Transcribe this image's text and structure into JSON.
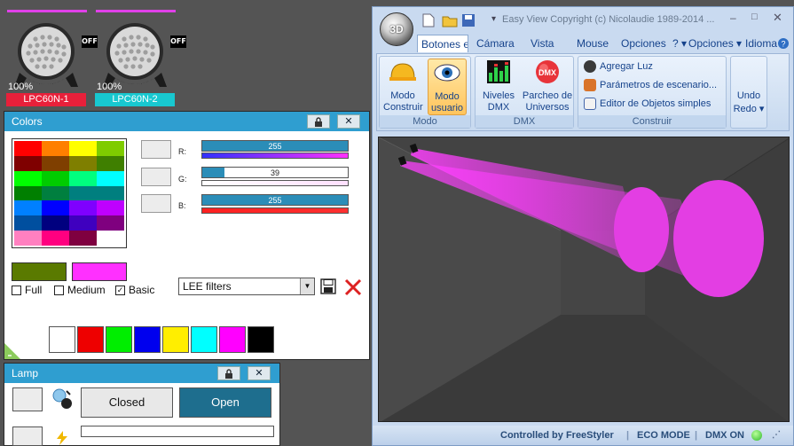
{
  "fixtures": [
    {
      "percent": "100%",
      "name": "LPC60N-1",
      "name_bg": "#e8203a",
      "status": "OFF"
    },
    {
      "percent": "100%",
      "name": "LPC60N-2",
      "name_bg": "#18c8d0",
      "status": "OFF"
    }
  ],
  "colors_panel": {
    "title": "Colors",
    "lock_icon": "lock-icon",
    "close_label": "✕",
    "palette": [
      "#ff0000",
      "#ff7f00",
      "#ffff00",
      "#7fcc00",
      "#7f0000",
      "#7f3f00",
      "#7f7f00",
      "#3f7f00",
      "#00ff00",
      "#00cc00",
      "#00ff7f",
      "#00ffff",
      "#007f00",
      "#007f3f",
      "#007f7f",
      "#007f7f",
      "#0080ff",
      "#0000ff",
      "#7f00ff",
      "#bf00ff",
      "#004f9f",
      "#00007f",
      "#3f00bf",
      "#7f007f",
      "#ff80c0",
      "#ff0080",
      "#7f0040",
      "#ffffff"
    ],
    "r_label": "R:",
    "g_label": "G:",
    "b_label": "B:",
    "r_value": "255",
    "g_value": "39",
    "b_value": "255",
    "r_fraction": 1.0,
    "g_fraction": 0.153,
    "b_fraction": 1.0,
    "current_color": "#ff30ff",
    "previous_color": "#5a7a00",
    "option_full": "Full",
    "option_medium": "Medium",
    "option_basic": "Basic",
    "basic_checked": "✓",
    "filter_select": "LEE filters",
    "quick_colors": [
      "#ffffff",
      "#ee0000",
      "#00ee00",
      "#0000ee",
      "#ffee00",
      "#00ffff",
      "#ff00ff",
      "#000000"
    ]
  },
  "lamp_panel": {
    "title": "Lamp",
    "closed_label": "Closed",
    "open_label": "Open",
    "close_label": "✕"
  },
  "window": {
    "title": "Easy View   Copyright (c) Nicolaudie 1989-2014 ...",
    "orb_label": "3D",
    "tabs": [
      "Botones e",
      "Cámara",
      "Vista",
      "Mouse",
      "Opciones",
      "? ▾",
      "Opciones ▾",
      "Idioma ▾"
    ],
    "groups": {
      "modo": "Modo",
      "dmx": "DMX",
      "construir": "Construir"
    },
    "buttons": {
      "modo_construir": "Modo Construir",
      "modo_usuario": "Modo usuario",
      "niveles_dmx": "Niveles DMX",
      "parcheo": "Parcheo de Universos",
      "agregar_luz": "Agregar Luz",
      "parametros": "Parámetros de escenario...",
      "editor": "Editor de Objetos simples",
      "undo": "Undo",
      "redo": "Redo ▾"
    },
    "status": {
      "controlled": "Controlled by FreeStyler",
      "eco": "ECO MODE",
      "dmx": "DMX ON"
    }
  }
}
